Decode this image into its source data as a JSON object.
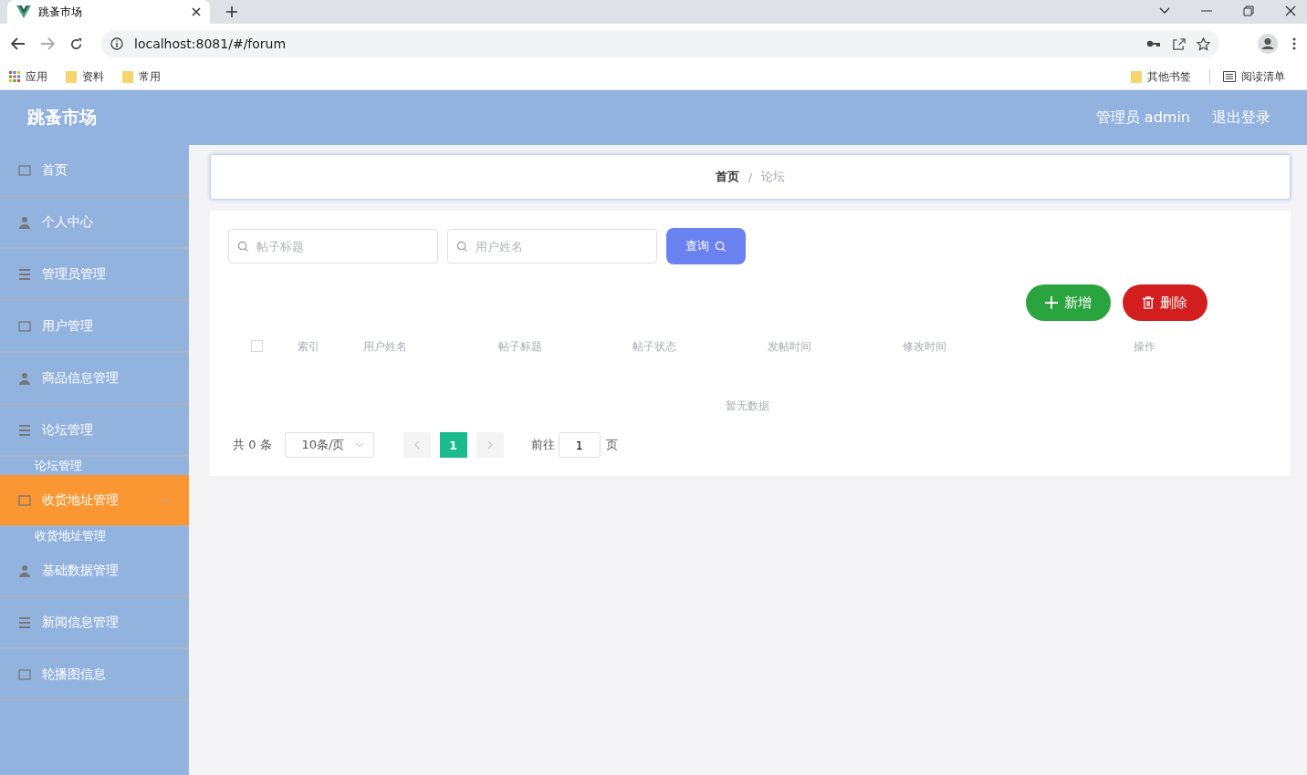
{
  "browser": {
    "tab_title": "跳蚤市场",
    "url": "localhost:8081/#/forum",
    "bookmarks": [
      "应用",
      "资料",
      "常用"
    ],
    "other_bookmarks": "其他书签",
    "reading_list": "阅读清单"
  },
  "header": {
    "title": "跳蚤市场",
    "user": "管理员 admin",
    "logout": "退出登录"
  },
  "sidebar": {
    "items": [
      {
        "label": "首页",
        "selected": false
      },
      {
        "label": "个人中心",
        "selected": false
      },
      {
        "label": "管理员管理",
        "selected": false,
        "expanded": false
      },
      {
        "label": "用户管理",
        "selected": false,
        "expanded": false
      },
      {
        "label": "商品信息管理",
        "selected": false,
        "expanded": false
      },
      {
        "label": "论坛管理",
        "selected": false,
        "expanded": true,
        "children": [
          {
            "label": "论坛管理"
          }
        ]
      },
      {
        "label": "收货地址管理",
        "selected": true,
        "expanded": true,
        "children": [
          {
            "label": "收货地址管理"
          }
        ]
      },
      {
        "label": "基础数据管理",
        "selected": false,
        "expanded": false
      },
      {
        "label": "新闻信息管理",
        "selected": false,
        "expanded": false
      },
      {
        "label": "轮播图信息",
        "selected": false,
        "expanded": false
      }
    ]
  },
  "breadcrumb": [
    "首页",
    "论坛"
  ],
  "breadcrumb_separator": "/",
  "search": {
    "fields": [
      {
        "placeholder": "帖子标题"
      },
      {
        "placeholder": "用户姓名"
      }
    ],
    "button": "查询"
  },
  "actions": [
    {
      "kind": "add",
      "label": "新增"
    },
    {
      "kind": "delete",
      "label": "删除"
    }
  ],
  "table": {
    "select_all_checked": false,
    "columns": [
      "索引",
      "用户姓名",
      "帖子标题",
      "帖子状态",
      "发帖时间",
      "修改时间",
      "操作"
    ],
    "empty_text": "暂无数据"
  },
  "pagination": {
    "total": "共 0 条",
    "page_size": "10条/页",
    "pages": [
      {
        "label": "1",
        "selected": true
      }
    ],
    "goto_label": "前往",
    "goto_value": "1",
    "goto_suffix": "页"
  }
}
